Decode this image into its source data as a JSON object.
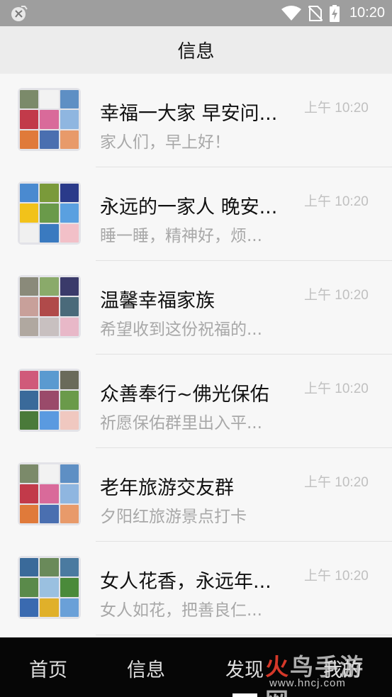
{
  "status_bar": {
    "time": "10:20",
    "icons": [
      "app-notification-icon",
      "wifi-icon",
      "no-sim-icon",
      "battery-charging-icon"
    ]
  },
  "header": {
    "title": "信息"
  },
  "conversations": [
    {
      "name": "幸福一大家 早安问...",
      "preview": "家人们，早上好！",
      "time": "上午 10:20"
    },
    {
      "name": "永远的一家人 晚安...",
      "preview": "睡一睡，精神好，烦...",
      "time": "上午 10:20"
    },
    {
      "name": "温馨幸福家族",
      "preview": "希望收到这份祝福的...",
      "time": "上午 10:20"
    },
    {
      "name": "众善奉行~佛光保佑",
      "preview": "祈愿保佑群里出入平...",
      "time": "上午 10:20"
    },
    {
      "name": "老年旅游交友群",
      "preview": "夕阳红旅游景点打卡",
      "time": "上午 10:20"
    },
    {
      "name": "女人花香，永远年...",
      "preview": "女人如花，把善良仁...",
      "time": "上午 10:20"
    }
  ],
  "bottom_nav": {
    "items": [
      "首页",
      "信息",
      "发现",
      "我的"
    ],
    "active": "发现"
  },
  "watermark": {
    "main": "火鸟手游网",
    "sub": "www.hncj.com"
  }
}
